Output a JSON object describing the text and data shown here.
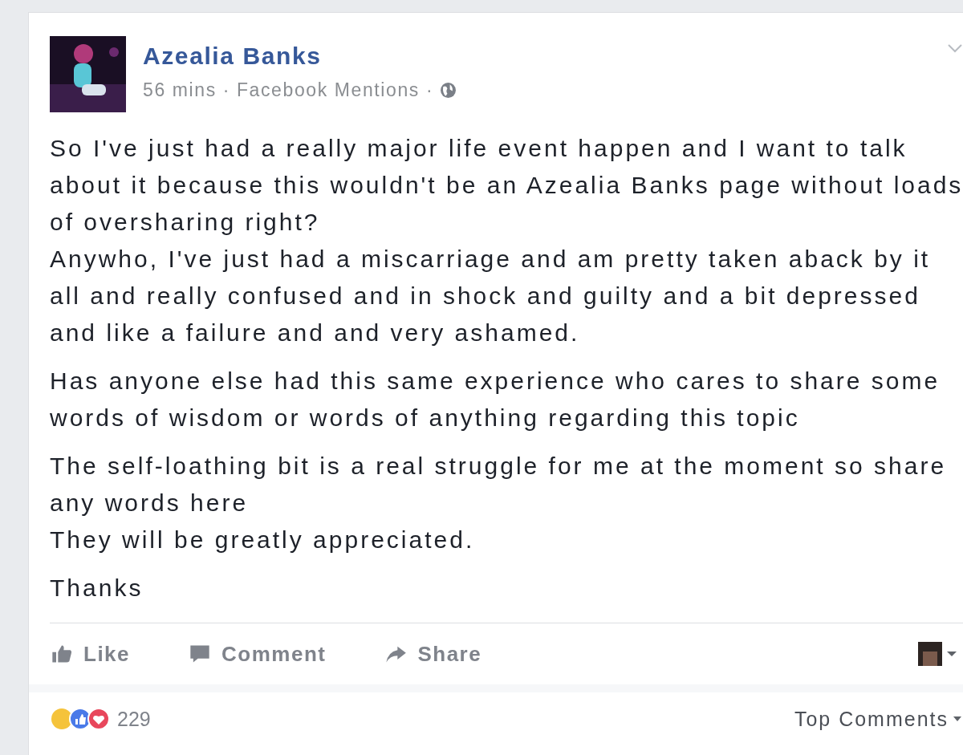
{
  "post": {
    "author": "Azealia Banks",
    "meta": "56 mins · Facebook Mentions ·",
    "paragraphs": [
      "So I've just had a really major life event happen and I want to talk about it because this wouldn't be an Azealia Banks page without loads of oversharing right?\nAnywho, I've just had a miscarriage and am pretty taken aback by it all and really confused and in shock and guilty and a bit depressed and like a failure and and very ashamed.",
      "Has anyone else had this same experience who cares to share some words of wisdom or words of anything regarding this topic",
      "The self-loathing bit is a real struggle for me at the moment so share any words here\nThey will be greatly appreciated.",
      "Thanks"
    ],
    "actions": [
      {
        "kind": "like",
        "label": "Like"
      },
      {
        "kind": "comment",
        "label": "Comment"
      },
      {
        "kind": "share",
        "label": "Share"
      }
    ],
    "reaction_count": "229",
    "sort": "Top Comments"
  }
}
